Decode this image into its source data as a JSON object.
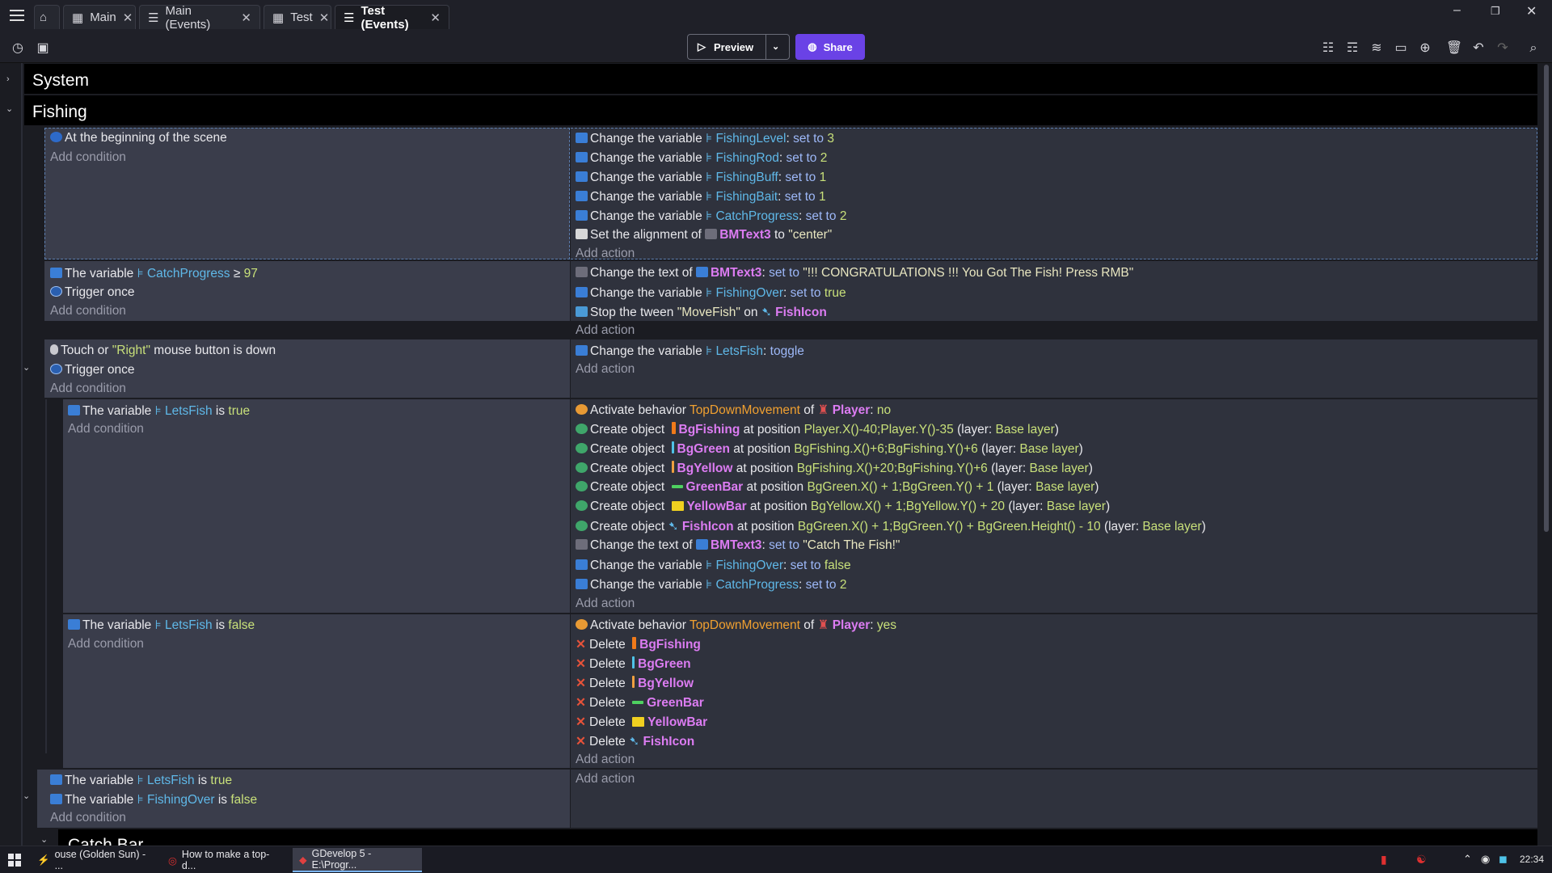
{
  "tabs": [
    {
      "label": "Main",
      "icon": "scene-icon"
    },
    {
      "label": "Main (Events)",
      "icon": "events-icon"
    },
    {
      "label": "Test",
      "icon": "scene-icon"
    },
    {
      "label": "Test (Events)",
      "icon": "events-icon"
    }
  ],
  "toolbar": {
    "preview_label": "Preview",
    "share_label": "Share"
  },
  "groups": {
    "system": "System",
    "fishing": "Fishing",
    "catch_bar": "Catch Bar"
  },
  "add_condition": "Add condition",
  "add_action": "Add action",
  "e1": {
    "cond": "At the beginning of the scene",
    "a1": {
      "pre": "Change the variable",
      "var": "FishingLevel",
      "op": "set to",
      "val": "3"
    },
    "a2": {
      "pre": "Change the variable",
      "var": "FishingRod",
      "op": "set to",
      "val": "2"
    },
    "a3": {
      "pre": "Change the variable",
      "var": "FishingBuff",
      "op": "set to",
      "val": "1"
    },
    "a4": {
      "pre": "Change the variable",
      "var": "FishingBait",
      "op": "set to",
      "val": "1"
    },
    "a5": {
      "pre": "Change the variable",
      "var": "CatchProgress",
      "op": "set to",
      "val": "2"
    },
    "a6": {
      "pre": "Set the alignment of",
      "obj": "BMText3",
      "mid": "to",
      "val": "\"center\""
    }
  },
  "e2": {
    "c1": {
      "pre": "The variable",
      "var": "CatchProgress",
      "op": "≥",
      "val": "97"
    },
    "c2": "Trigger once",
    "a1": {
      "pre": "Change the text of",
      "obj": "BMText3",
      "op": "set to",
      "val": "\"!!! CONGRATULATIONS !!! You Got The Fish! Press RMB\""
    },
    "a2": {
      "pre": "Change the variable",
      "var": "FishingOver",
      "op": "set to",
      "val": "true"
    },
    "a3": {
      "pre": "Stop the tween",
      "val": "\"MoveFish\"",
      "mid": "on",
      "obj": "FishIcon"
    }
  },
  "e3": {
    "c1": {
      "pre": "Touch or",
      "val": "\"Right\"",
      "post": "mouse button is down"
    },
    "c2": "Trigger once",
    "a1": {
      "pre": "Change the variable",
      "var": "LetsFish",
      "op": "toggle"
    }
  },
  "e4": {
    "c1": {
      "pre": "The variable",
      "var": "LetsFish",
      "op": "is",
      "val": "true"
    },
    "a1": {
      "pre": "Activate behavior",
      "behav": "TopDownMovement",
      "mid": "of",
      "obj": "Player",
      "val": "no"
    },
    "a2": {
      "pre": "Create object",
      "obj": "BgFishing",
      "mid": "at position",
      "val": "Player.X()-40;Player.Y()-35",
      "layer_pre": "(layer:",
      "layer": "Base layer",
      "close": ")"
    },
    "a3": {
      "pre": "Create object",
      "obj": "BgGreen",
      "mid": "at position",
      "val": "BgFishing.X()+6;BgFishing.Y()+6",
      "layer_pre": "(layer:",
      "layer": "Base layer",
      "close": ")"
    },
    "a4": {
      "pre": "Create object",
      "obj": "BgYellow",
      "mid": "at position",
      "val": "BgFishing.X()+20;BgFishing.Y()+6",
      "layer_pre": "(layer:",
      "layer": "Base layer",
      "close": ")"
    },
    "a5": {
      "pre": "Create object",
      "obj": "GreenBar",
      "mid": "at position",
      "val": "BgGreen.X() + 1;BgGreen.Y() + 1",
      "layer_pre": "(layer:",
      "layer": "Base layer",
      "close": ")"
    },
    "a6": {
      "pre": "Create object",
      "obj": "YellowBar",
      "mid": "at position",
      "val": "BgYellow.X() + 1;BgYellow.Y() + 20",
      "layer_pre": "(layer:",
      "layer": "Base layer",
      "close": ")"
    },
    "a7": {
      "pre": "Create object",
      "obj": "FishIcon",
      "mid": "at position",
      "val": "BgGreen.X() + 1;BgGreen.Y() + BgGreen.Height() - 10",
      "layer_pre": "(layer:",
      "layer": "Base layer",
      "close": ")"
    },
    "a8": {
      "pre": "Change the text of",
      "obj": "BMText3",
      "op": "set to",
      "val": "\"Catch The Fish!\""
    },
    "a9": {
      "pre": "Change the variable",
      "var": "FishingOver",
      "op": "set to",
      "val": "false"
    },
    "a10": {
      "pre": "Change the variable",
      "var": "CatchProgress",
      "op": "set to",
      "val": "2"
    }
  },
  "e5": {
    "c1": {
      "pre": "The variable",
      "var": "LetsFish",
      "op": "is",
      "val": "false"
    },
    "a1": {
      "pre": "Activate behavior",
      "behav": "TopDownMovement",
      "mid": "of",
      "obj": "Player",
      "val": "yes"
    },
    "delete_label": "Delete",
    "deletes": [
      "BgFishing",
      "BgGreen",
      "BgYellow",
      "GreenBar",
      "YellowBar",
      "FishIcon"
    ]
  },
  "e6": {
    "c1": {
      "pre": "The variable",
      "var": "LetsFish",
      "op": "is",
      "val": "true"
    },
    "c2": {
      "pre": "The variable",
      "var": "FishingOver",
      "op": "is",
      "val": "false"
    }
  },
  "taskbar": {
    "items": [
      "ouse (Golden Sun) - ...",
      "How to make a top-d...",
      "GDevelop 5 - E:\\Progr..."
    ],
    "clock": "22:34"
  }
}
